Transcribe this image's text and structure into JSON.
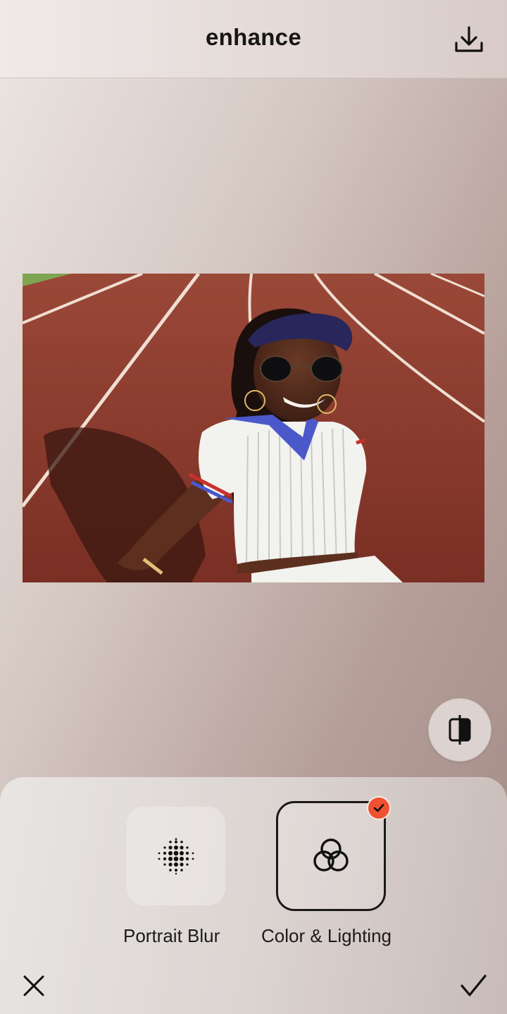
{
  "header": {
    "title": "enhance",
    "download_icon": "download-icon"
  },
  "photo": {
    "icon": "photo-image"
  },
  "compare": {
    "icon": "compare-split-icon"
  },
  "tools": [
    {
      "label": "Portrait Blur",
      "icon": "portrait-blur-dots-icon",
      "selected": false
    },
    {
      "label": "Color & Lighting",
      "icon": "color-lighting-rings-icon",
      "selected": true
    }
  ],
  "footer": {
    "cancel_icon": "close-icon",
    "confirm_icon": "checkmark-icon"
  },
  "colors": {
    "accent": "#f0512f",
    "text": "#161616"
  }
}
